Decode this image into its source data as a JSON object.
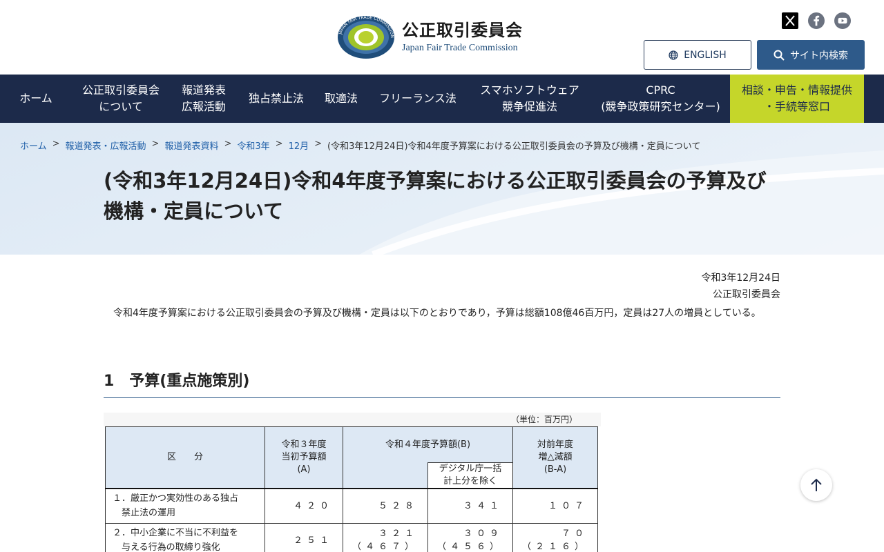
{
  "header": {
    "logo_jp": "公正取引委員会",
    "logo_en": "Japan Fair Trade Commission",
    "logo_ring_text": "JAPAN FAIR TRADE COMMISSION",
    "english_label": "ENGLISH",
    "search_label": "サイト内検索",
    "social": [
      "x-icon",
      "facebook-icon",
      "youtube-icon"
    ]
  },
  "nav": {
    "items": [
      {
        "label": "ホーム"
      },
      {
        "label": "公正取引委員会\nについて"
      },
      {
        "label": "報道発表\n広報活動"
      },
      {
        "label": "独占禁止法"
      },
      {
        "label": "取適法"
      },
      {
        "label": "フリーランス法"
      },
      {
        "label": "スマホソフトウェア\n競争促進法"
      },
      {
        "label": "CPRC\n(競争政策研究センター)"
      },
      {
        "label": "相談・申告・情報提供\n・手続等窓口"
      }
    ]
  },
  "breadcrumb": {
    "items": [
      "ホーム",
      "報道発表・広報活動",
      "報道発表資料",
      "令和3年",
      "12月"
    ],
    "current": "(令和3年12月24日)令和4年度予算案における公正取引委員会の予算及び機構・定員について",
    "separator": ">"
  },
  "page": {
    "title": "(令和3年12月24日)令和4年度予算案における公正取引委員会の予算及び機構・定員について",
    "date": "令和3年12月24日",
    "org": "公正取引委員会",
    "intro": "令和4年度予算案における公正取引委員会の予算及び機構・定員は以下のとおりであり，予算は総額108億46百万円，定員は27人の増員としている。",
    "section1": "1　予算(重点施策別)"
  },
  "table": {
    "unit": "（単位：百万円）",
    "head_category": "区　　分",
    "head_a": "令和３年度\n当初予算額\n(A)",
    "head_b": "令和４年度予算額(B)",
    "head_b_sub": "デジタル庁一括\n計上分を除く",
    "head_diff": "対前年度\n増△減額\n(B-A)",
    "rows": [
      {
        "label": "１．厳正かつ実効性のある独占\n　禁止法の運用",
        "a": "４２０",
        "b": "５２８",
        "b_sub": "３４１",
        "diff": "１０７"
      },
      {
        "label": "２．中小企業に不当に不利益を\n　与える行為の取締り強化",
        "a": "２５１",
        "b": "３２１\n（４６７）",
        "b_sub": "３０９\n（４５６）",
        "diff": "７０\n（２１６）"
      }
    ]
  },
  "colors": {
    "nav_bg": "#1c2a4a",
    "consult_bg": "#c5d62a",
    "search_btn": "#2e5a8a",
    "link": "#1f5fa8",
    "table_head": "#dde8f4"
  }
}
